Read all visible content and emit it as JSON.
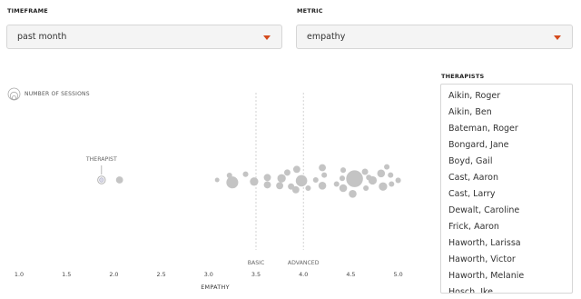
{
  "filters": {
    "timeframe": {
      "label": "TIMEFRAME",
      "value": "past month"
    },
    "metric": {
      "label": "METRIC",
      "value": "empathy"
    }
  },
  "legend": {
    "label": "NUMBER OF SESSIONS",
    "icon": "concentric-circles-icon"
  },
  "therapists": {
    "label": "THERAPISTS",
    "items": [
      "Aikin, Roger",
      "Aikin, Ben",
      "Bateman, Roger",
      "Bongard, Jane",
      "Boyd, Gail",
      "Cast, Aaron",
      "Cast, Larry",
      "Dewalt, Caroline",
      "Frick, Aaron",
      "Haworth, Larissa",
      "Haworth, Victor",
      "Haworth, Melanie",
      "Hosch, Ike"
    ]
  },
  "chart_data": {
    "type": "scatter",
    "xlabel": "EMPATHY",
    "xlim": [
      0.9,
      5.1
    ],
    "ticks": [
      "1.0",
      "1.5",
      "2.0",
      "2.5",
      "3.0",
      "3.5",
      "4.0",
      "4.5",
      "5.0"
    ],
    "thresholds": [
      {
        "label": "BASIC",
        "x": 3.5
      },
      {
        "label": "ADVANCED",
        "x": 4.0
      }
    ],
    "highlight": {
      "label": "THERAPIST",
      "x": 1.87,
      "y": 0,
      "sessions": 2
    },
    "size_encodes": "number of sessions",
    "points": [
      {
        "x": 2.06,
        "y": 0,
        "sessions": 5
      },
      {
        "x": 3.09,
        "y": 0,
        "sessions": 2
      },
      {
        "x": 3.25,
        "y": -0.3,
        "sessions": 14
      },
      {
        "x": 3.22,
        "y": 0.55,
        "sessions": 3
      },
      {
        "x": 3.39,
        "y": 0.7,
        "sessions": 3
      },
      {
        "x": 3.48,
        "y": -0.2,
        "sessions": 7
      },
      {
        "x": 3.62,
        "y": -0.6,
        "sessions": 5
      },
      {
        "x": 3.62,
        "y": 0.3,
        "sessions": 5
      },
      {
        "x": 3.75,
        "y": -0.7,
        "sessions": 5
      },
      {
        "x": 3.77,
        "y": 0.2,
        "sessions": 7
      },
      {
        "x": 3.83,
        "y": 0.9,
        "sessions": 4
      },
      {
        "x": 3.87,
        "y": -0.8,
        "sessions": 4
      },
      {
        "x": 3.92,
        "y": -1.2,
        "sessions": 5
      },
      {
        "x": 3.93,
        "y": 1.3,
        "sessions": 5
      },
      {
        "x": 3.98,
        "y": -0.1,
        "sessions": 13
      },
      {
        "x": 4.05,
        "y": -1.0,
        "sessions": 3
      },
      {
        "x": 4.13,
        "y": 0.0,
        "sessions": 3
      },
      {
        "x": 4.2,
        "y": 1.5,
        "sessions": 5
      },
      {
        "x": 4.2,
        "y": -0.7,
        "sessions": 6
      },
      {
        "x": 4.22,
        "y": 0.6,
        "sessions": 3
      },
      {
        "x": 4.35,
        "y": -0.5,
        "sessions": 3
      },
      {
        "x": 4.41,
        "y": 0.2,
        "sessions": 3
      },
      {
        "x": 4.42,
        "y": 1.2,
        "sessions": 3
      },
      {
        "x": 4.42,
        "y": -1.0,
        "sessions": 6
      },
      {
        "x": 4.52,
        "y": -1.7,
        "sessions": 6
      },
      {
        "x": 4.54,
        "y": 0.15,
        "sessions": 28
      },
      {
        "x": 4.65,
        "y": 1.0,
        "sessions": 4
      },
      {
        "x": 4.66,
        "y": -1.0,
        "sessions": 3
      },
      {
        "x": 4.69,
        "y": 0.3,
        "sessions": 3
      },
      {
        "x": 4.73,
        "y": -0.05,
        "sessions": 7
      },
      {
        "x": 4.82,
        "y": 0.8,
        "sessions": 6
      },
      {
        "x": 4.84,
        "y": -0.8,
        "sessions": 7
      },
      {
        "x": 4.88,
        "y": 1.6,
        "sessions": 3
      },
      {
        "x": 4.92,
        "y": 0.6,
        "sessions": 3
      },
      {
        "x": 4.93,
        "y": -0.5,
        "sessions": 3
      },
      {
        "x": 5.0,
        "y": -0.05,
        "sessions": 3
      }
    ],
    "colors": {
      "point": "#c4c4c4",
      "highlight_ring": "#b3b3b3",
      "highlight_fill": "#d9d9e6",
      "guide": "#c8c8c8"
    }
  }
}
